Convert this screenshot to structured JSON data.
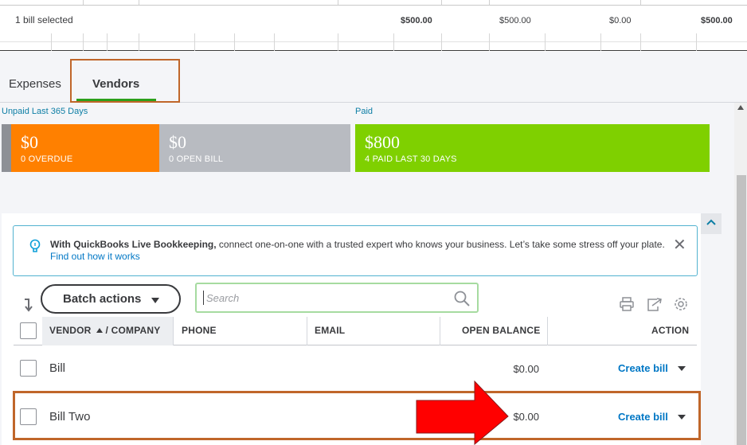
{
  "top": {
    "selected_text": "1 bill selected",
    "amounts": [
      "$500.00",
      "$500.00",
      "$0.00",
      "$500.00"
    ]
  },
  "tabs": [
    {
      "label": "Expenses",
      "active": false
    },
    {
      "label": "Vendors",
      "active": true
    }
  ],
  "summary": {
    "unpaid_label": "Unpaid Last 365 Days",
    "paid_label": "Paid",
    "overdue": {
      "amount": "$0",
      "caption": "0 OVERDUE",
      "color": "#ff8000"
    },
    "open_bill": {
      "amount": "$0",
      "caption": "0 OPEN BILL",
      "color": "#b8bbc1"
    },
    "paid": {
      "amount": "$800",
      "caption": "4 PAID LAST 30 DAYS",
      "color": "#7fd000"
    }
  },
  "banner": {
    "bold_text": "With QuickBooks Live Bookkeeping,",
    "text": " connect one-on-one with a trusted expert who knows your business. Let’s take some stress off your plate. ",
    "link": "Find out how it works",
    "icon": "lightbulb-icon"
  },
  "toolbar": {
    "batch_label": "Batch actions",
    "search_placeholder": "Search"
  },
  "table": {
    "headers": {
      "vendor": "VENDOR",
      "company": "/ COMPANY",
      "phone": "PHONE",
      "email": "EMAIL",
      "balance": "OPEN BALANCE",
      "action": "ACTION"
    },
    "rows": [
      {
        "name": "Bill",
        "balance": "$0.00",
        "action": "Create bill"
      },
      {
        "name": "Bill Two",
        "balance": "$0.00",
        "action": "Create bill"
      }
    ]
  },
  "colors": {
    "accent_green": "#2ca01c",
    "link_blue": "#0077c5",
    "annotation_border": "#c0662a",
    "annotation_arrow": "#ff0000"
  }
}
